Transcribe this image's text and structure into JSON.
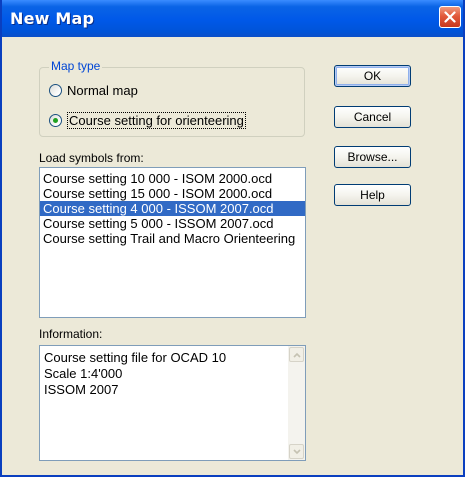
{
  "window": {
    "title": "New Map"
  },
  "map_type": {
    "legend": "Map type",
    "options": [
      {
        "label": "Normal map",
        "checked": false
      },
      {
        "label": "Course setting for orienteering",
        "checked": true
      }
    ]
  },
  "symbols": {
    "label": "Load symbols from:",
    "items": [
      "Course setting 10 000 - ISOM 2000.ocd",
      "Course setting 15 000 - ISOM 2000.ocd",
      "Course setting 4 000 - ISSOM 2007.ocd",
      "Course setting 5 000 - ISSOM 2007.ocd",
      "Course setting Trail and Macro Orienteering"
    ],
    "selected_index": 2
  },
  "information": {
    "label": "Information:",
    "lines": [
      "Course setting file for OCAD 10",
      "Scale 1:4'000",
      "ISSOM 2007"
    ]
  },
  "buttons": {
    "ok": "OK",
    "cancel": "Cancel",
    "browse": "Browse...",
    "help": "Help"
  },
  "colors": {
    "titlebar": "#0054E3",
    "dialog_background": "#ECE9D8",
    "selection": "#316AC5",
    "group_legend": "#0046D5",
    "close_button": "#E2583A"
  }
}
